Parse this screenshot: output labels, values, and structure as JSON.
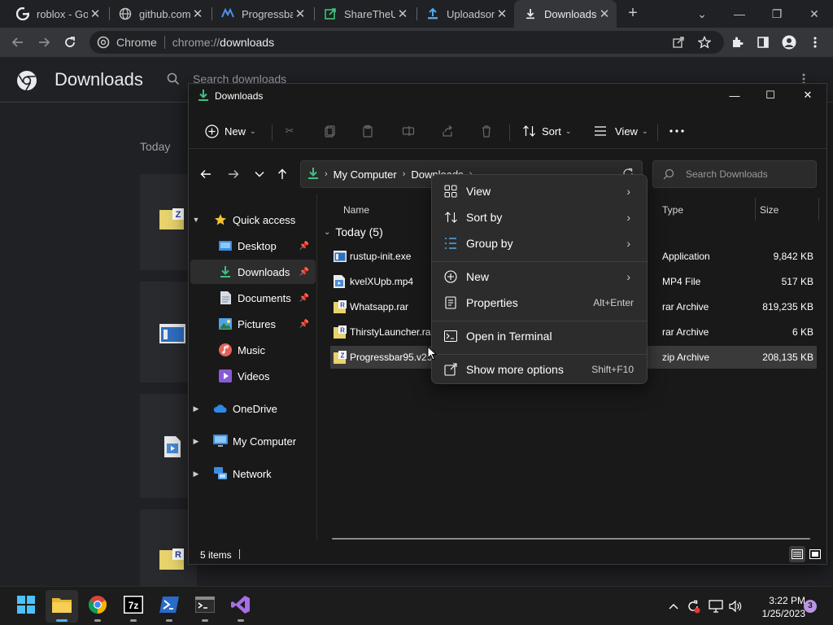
{
  "browser": {
    "tabs": [
      {
        "title": "roblox - Go",
        "icon": "google-icon"
      },
      {
        "title": "github.com",
        "icon": "globe-icon"
      },
      {
        "title": "Progressba",
        "icon": "progressbar-icon"
      },
      {
        "title": "ShareTheU",
        "icon": "share-icon"
      },
      {
        "title": "Uploadson",
        "icon": "upload-icon"
      },
      {
        "title": "Downloads",
        "icon": "download-icon",
        "active": true
      }
    ],
    "omnibox": {
      "site": "Chrome",
      "url_prefix": "chrome://",
      "url_path": "downloads"
    }
  },
  "downloads_page": {
    "title": "Downloads",
    "search_placeholder": "Search downloads",
    "section": "Today"
  },
  "explorer": {
    "title": "Downloads",
    "commands": {
      "new": "New",
      "sort": "Sort",
      "view": "View"
    },
    "breadcrumb": [
      "My Computer",
      "Downloads"
    ],
    "search_placeholder": "Search Downloads",
    "nav": {
      "quick_access": "Quick access",
      "items": [
        "Desktop",
        "Downloads",
        "Documents",
        "Pictures",
        "Music",
        "Videos"
      ],
      "onedrive": "OneDrive",
      "mycomputer": "My Computer",
      "network": "Network"
    },
    "columns": {
      "name": "Name",
      "type": "Type",
      "size": "Size"
    },
    "group": "Today (5)",
    "files": [
      {
        "name": "rustup-init.exe",
        "type": "Application",
        "size": "9,842 KB"
      },
      {
        "name": "kvelXUpb.mp4",
        "type": "MP4 File",
        "size": "517 KB"
      },
      {
        "name": "Whatsapp.rar",
        "type": "rar Archive",
        "size": "819,235 KB"
      },
      {
        "name": "ThirstyLauncher.rar",
        "type": "rar Archive",
        "size": "6 KB"
      },
      {
        "name": "Progressbar95.v20",
        "type": "zip Archive",
        "size": "208,135 KB",
        "selected": true
      }
    ],
    "status": "5 items"
  },
  "context_menu": {
    "view": "View",
    "sort_by": "Sort by",
    "group_by": "Group by",
    "new": "New",
    "properties": "Properties",
    "properties_shortcut": "Alt+Enter",
    "open_terminal": "Open in Terminal",
    "show_more": "Show more options",
    "show_more_shortcut": "Shift+F10"
  },
  "taskbar": {
    "time": "3:22 PM",
    "date": "1/25/2023",
    "notifications": "3"
  },
  "colors": {
    "accent": "#58b2e6",
    "explorer_bg": "#191919",
    "menu_bg": "#2c2c2c",
    "chrome_bg": "#202124"
  }
}
